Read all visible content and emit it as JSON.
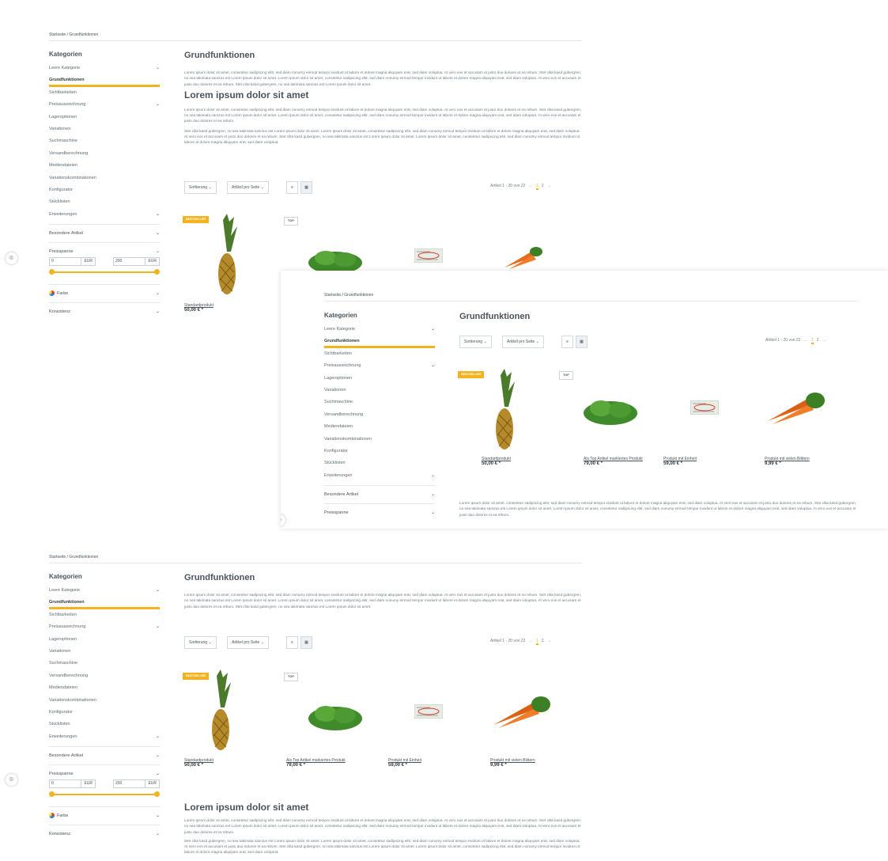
{
  "breadcrumb": {
    "home": "Startseite",
    "sep": "/",
    "current": "Grundfunktionen"
  },
  "sidebar": {
    "heading": "Kategorien",
    "items": [
      {
        "label": "Leere Kategorie",
        "chevron": true
      },
      {
        "label": "Grundfunktionen",
        "active": true
      },
      {
        "label": "Sichtbarkeiten"
      },
      {
        "label": "Preisauszeichnung",
        "chevron": true
      },
      {
        "label": "Lageroptionen"
      },
      {
        "label": "Variationen"
      },
      {
        "label": "Suchmaschine"
      },
      {
        "label": "Versandberechnung"
      },
      {
        "label": "Mediendateien"
      },
      {
        "label": "Variationskombinationen"
      },
      {
        "label": "Konfigurator"
      },
      {
        "label": "Stücklisten"
      },
      {
        "label": "Erweiterungen",
        "chevron": true
      }
    ],
    "filters": {
      "special": "Besondere Artikel",
      "price": "Preisspanne",
      "price_min": "0",
      "price_max": "200",
      "currency": "EUR",
      "color": "Farbe",
      "consistency": "Konsistenz"
    }
  },
  "main": {
    "title": "Grundfunktionen",
    "subtitle": "Lorem ipsum dolor sit amet",
    "para1": "Lorem ipsum dolor sit amet, consetetur sadipscing elitr, sed diam nonumy eirmod tempor invidunt ut labore et dolore magna aliquyam erat, sed diam voluptua. At vero eos et accusam et justo duo dolores et ea rebum. Stet clita kasd gubergren, no sea takimata sanctus est Lorem ipsum dolor sit amet. Lorem ipsum dolor sit amet, consetetur sadipscing elitr, sed diam nonumy eirmod tempor invidunt ut labore et dolore magna aliquyam erat, sed diam voluptua. At vero eos et accusam et justo duo dolores et ea rebum. Stet clita kasd gubergren, no sea takimata sanctus est Lorem ipsum dolor sit amet.",
    "para2": "Lorem ipsum dolor sit amet, consetetur sadipscing elitr, sed diam nonumy eirmod tempor invidunt ut labore et dolore magna aliquyam erat, sed diam voluptua. At vero eos et accusam et justo duo dolores et ea rebum. Stet clita kasd gubergren, no sea takimata sanctus est Lorem ipsum dolor sit amet. Lorem ipsum dolor sit amet, consetetur sadipscing elitr, sed diam nonumy eirmod tempor invidunt ut labore et dolore magna aliquyam erat, sed diam voluptua. At vero eos et accusam et justo duo dolores et ea rebum.",
    "para3": "Stet clita kasd gubergren, no sea takimata sanctus est Lorem ipsum dolor sit amet. Lorem ipsum dolor sit amet, consetetur sadipscing elitr, sed diam nonumy eirmod tempor invidunt ut labore et dolore magna aliquyam erat, sed diam voluptua. At vero eos et accusam et justo duo dolores et ea rebum. Stet clita kasd gubergren, no sea takimata sanctus est Lorem ipsum dolor sit amet. Lorem ipsum dolor sit amet, consetetur sadipscing elitr, sed diam nonumy eirmod tempor invidunt ut labore et dolore magna aliquyam erat, sed diam voluptua."
  },
  "toolbar": {
    "sort": "Sortierung",
    "per_page": "Artikel pro Seite",
    "count": "Artikel 1 - 20 von 22",
    "page1": "1",
    "page2": "2",
    "prev": "←",
    "next": "→"
  },
  "badges": {
    "bestseller": "BESTSELLER",
    "top": "TOP"
  },
  "products": [
    {
      "name": "Standardprodukt",
      "price": "50,00 € *"
    },
    {
      "name": "Als Top Artikel markiertes Produkt",
      "price": "79,00 € *"
    },
    {
      "name": "Produkt mit Einheit",
      "price": "59,00 € *"
    },
    {
      "name": "Produkt mit vielen Bildern",
      "price": "9,99 € *"
    }
  ],
  "colors": {
    "accent": "#f2b31f",
    "text": "#4a545b",
    "muted": "#707b84"
  }
}
